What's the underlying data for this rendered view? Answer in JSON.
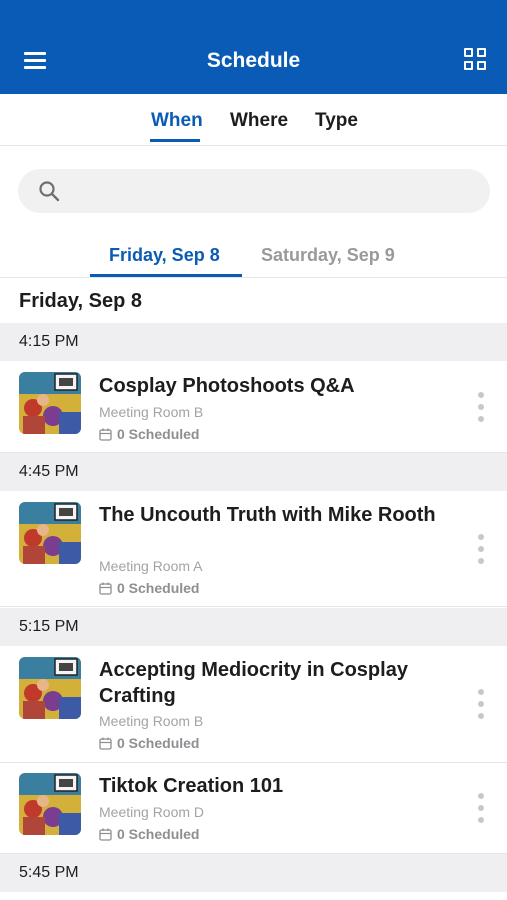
{
  "header": {
    "title": "Schedule",
    "menu_icon": "hamburger-menu-icon",
    "view_icon": "grid-view-icon",
    "bar_color": "#0a5bb5"
  },
  "filter_tabs": [
    {
      "label": "When",
      "active": true
    },
    {
      "label": "Where",
      "active": false
    },
    {
      "label": "Type",
      "active": false
    }
  ],
  "search": {
    "placeholder": "",
    "value": ""
  },
  "day_tabs": [
    {
      "label": "Friday, Sep 8",
      "active": true
    },
    {
      "label": "Saturday, Sep 9",
      "active": false
    }
  ],
  "day_heading": "Friday, Sep 8",
  "time_slots": [
    {
      "time": "4:15 PM"
    },
    {
      "time": "4:45 PM"
    },
    {
      "time": "5:15 PM"
    },
    {
      "time": "5:45 PM"
    }
  ],
  "sessions": [
    {
      "title": "Cosplay Photoshoots Q&A",
      "room": "Meeting Room B",
      "scheduled": "0 Scheduled"
    },
    {
      "title": "The Uncouth Truth with Mike Rooth",
      "room": "Meeting Room A",
      "scheduled": "0 Scheduled"
    },
    {
      "title": "Accepting Mediocrity in Cosplay Crafting",
      "room": "Meeting Room B",
      "scheduled": "0 Scheduled"
    },
    {
      "title": "Tiktok Creation 101",
      "room": "Meeting Room D",
      "scheduled": "0 Scheduled"
    }
  ],
  "colors": {
    "accent": "#0a5bb5",
    "section_bg": "#efeff1",
    "muted": "#a3a3a8"
  }
}
